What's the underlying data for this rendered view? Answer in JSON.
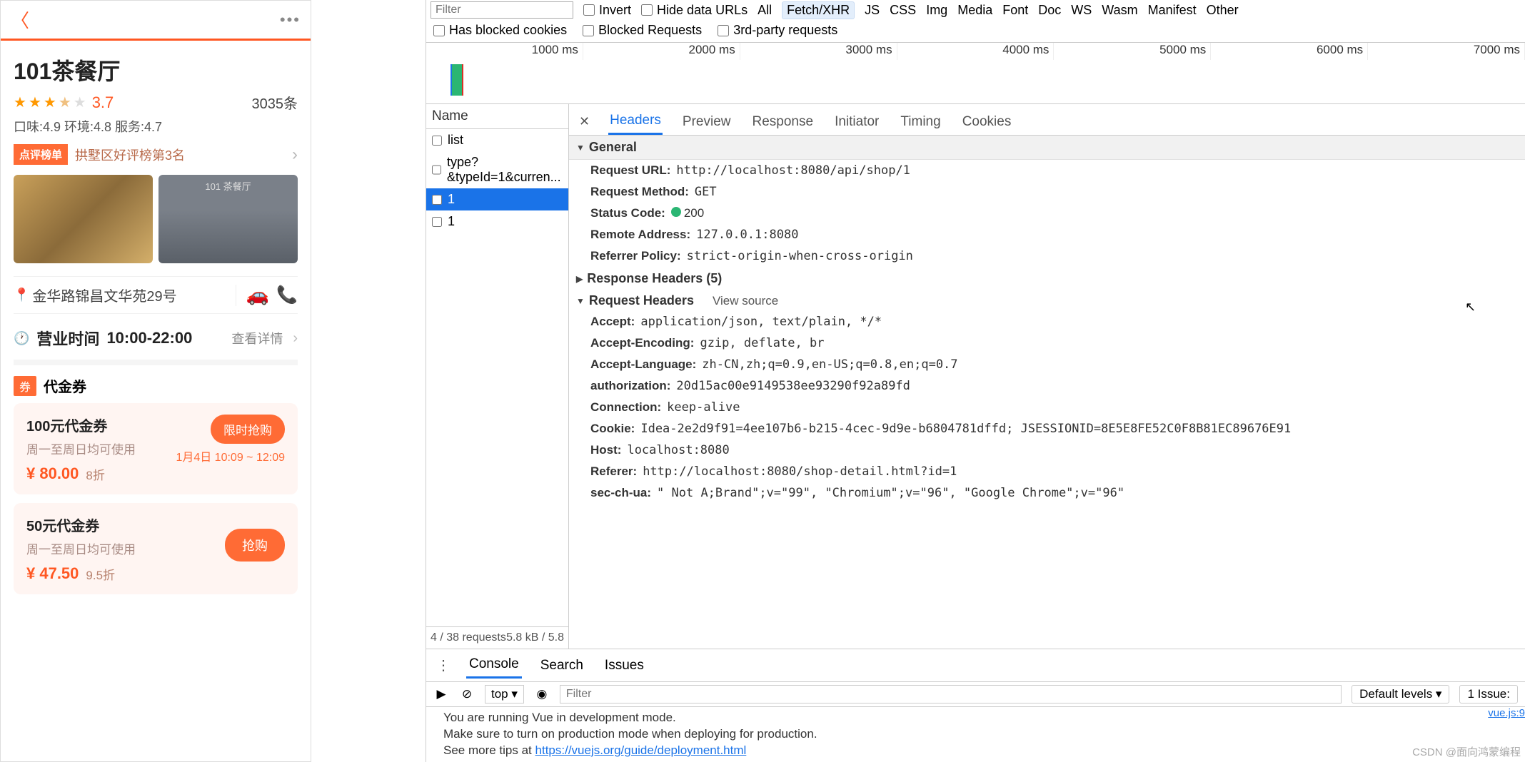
{
  "mobile": {
    "shop_name": "101茶餐厅",
    "rating": "3.7",
    "review_count": "3035条",
    "subratings": "口味:4.9 环境:4.8 服务:4.7",
    "rank_badge": "点评榜单",
    "rank_text": "拱墅区好评榜第3名",
    "photo2_caption": "101 茶餐厅",
    "address": "金华路锦昌文华苑29号",
    "hours_label": "营业时间",
    "hours_time": "10:00-22:00",
    "hours_detail": "查看详情",
    "coupon_section": "代金券",
    "coupon_badge": "券",
    "coupons": [
      {
        "name": "100元代金券",
        "note": "周一至周日均可使用",
        "price": "¥ 80.00",
        "discount": "8折",
        "btn": "限时抢购",
        "timeslot": "1月4日 10:09 ~ 12:09"
      },
      {
        "name": "50元代金券",
        "note": "周一至周日均可使用",
        "price": "¥ 47.50",
        "discount": "9.5折",
        "btn": "抢购"
      }
    ]
  },
  "devtools": {
    "filter_placeholder": "Filter",
    "invert": "Invert",
    "hide_data_urls": "Hide data URLs",
    "ft": {
      "all": "All",
      "fetch": "Fetch/XHR",
      "js": "JS",
      "css": "CSS",
      "img": "Img",
      "media": "Media",
      "font": "Font",
      "doc": "Doc",
      "ws": "WS",
      "wasm": "Wasm",
      "manifest": "Manifest",
      "other": "Other"
    },
    "blocked_cookies": "Has blocked cookies",
    "blocked_requests": "Blocked Requests",
    "third_party": "3rd-party requests",
    "timeline_ticks": [
      "1000 ms",
      "2000 ms",
      "3000 ms",
      "4000 ms",
      "5000 ms",
      "6000 ms",
      "7000 ms"
    ],
    "name_header": "Name",
    "name_items": [
      "list",
      "type?&typeId=1&curren...",
      "1",
      "1"
    ],
    "name_footer_left": "4 / 38 requests",
    "name_footer_right": "5.8 kB / 5.8",
    "tabs": {
      "headers": "Headers",
      "preview": "Preview",
      "response": "Response",
      "initiator": "Initiator",
      "timing": "Timing",
      "cookies": "Cookies"
    },
    "general": {
      "title": "General",
      "url_k": "Request URL:",
      "url_v": "http://localhost:8080/api/shop/1",
      "method_k": "Request Method:",
      "method_v": "GET",
      "status_k": "Status Code:",
      "status_v": "200",
      "remote_k": "Remote Address:",
      "remote_v": "127.0.0.1:8080",
      "referrer_k": "Referrer Policy:",
      "referrer_v": "strict-origin-when-cross-origin"
    },
    "resp_headers_title": "Response Headers (5)",
    "req_headers_title": "Request Headers",
    "view_source": "View source",
    "req": {
      "accept_k": "Accept:",
      "accept_v": "application/json, text/plain, */*",
      "enc_k": "Accept-Encoding:",
      "enc_v": "gzip, deflate, br",
      "lang_k": "Accept-Language:",
      "lang_v": "zh-CN,zh;q=0.9,en-US;q=0.8,en;q=0.7",
      "auth_k": "authorization:",
      "auth_v": "20d15ac00e9149538ee93290f92a89fd",
      "conn_k": "Connection:",
      "conn_v": "keep-alive",
      "cookie_k": "Cookie:",
      "cookie_v": "Idea-2e2d9f91=4ee107b6-b215-4cec-9d9e-b6804781dffd; JSESSIONID=8E5E8FE52C0F8B81EC89676E91",
      "host_k": "Host:",
      "host_v": "localhost:8080",
      "referer_k": "Referer:",
      "referer_v": "http://localhost:8080/shop-detail.html?id=1",
      "secua_k": "sec-ch-ua:",
      "secua_v": "\" Not A;Brand\";v=\"99\", \"Chromium\";v=\"96\", \"Google Chrome\";v=\"96\""
    },
    "drawer": {
      "console": "Console",
      "search": "Search",
      "issues": "Issues",
      "top": "top ▾",
      "filter_placeholder": "Filter",
      "default_levels": "Default levels ▾",
      "issue_count": "1 Issue:",
      "line1": "You are running Vue in development mode.",
      "line2": "Make sure to turn on production mode when deploying for production.",
      "line3a": "See more tips at ",
      "line3b": "https://vuejs.org/guide/deployment.html",
      "vuejs_right": "vue.js:9"
    }
  },
  "watermark": "CSDN @面向鸿蒙编程"
}
